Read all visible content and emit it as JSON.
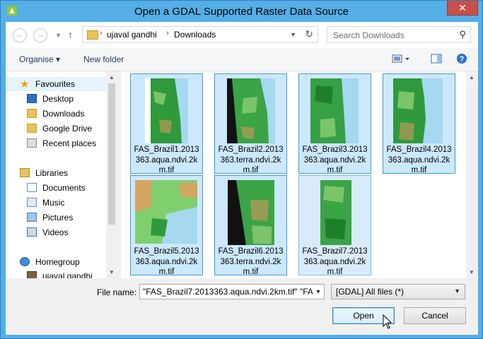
{
  "window": {
    "title": "Open a GDAL Supported Raster Data Source",
    "close_label": "✕"
  },
  "nav": {
    "back_icon": "back-arrow-icon",
    "forward_icon": "forward-arrow-icon",
    "up_icon": "up-arrow-icon",
    "breadcrumb": [
      "ujaval gandhi",
      "Downloads"
    ],
    "search_placeholder": "Search Downloads"
  },
  "toolbar": {
    "organise_label": "Organise ▾",
    "new_folder_label": "New folder"
  },
  "sidebar": {
    "favourites_label": "Favourites",
    "favourites": [
      "Desktop",
      "Downloads",
      "Google Drive",
      "Recent places"
    ],
    "libraries_label": "Libraries",
    "libraries": [
      "Documents",
      "Music",
      "Pictures",
      "Videos"
    ],
    "homegroup_label": "Homegroup",
    "homegroup_user": "ujaval gandhi"
  },
  "files": [
    {
      "name": "FAS_Brazil1.2013363.aqua.ndvi.2km.tif",
      "selected": true
    },
    {
      "name": "FAS_Brazil2.2013363.terra.ndvi.2km.tif",
      "selected": true
    },
    {
      "name": "FAS_Brazil3.2013363.aqua.ndvi.2km.tif",
      "selected": true
    },
    {
      "name": "FAS_Brazil4.2013363.aqua.ndvi.2km.tif",
      "selected": true
    },
    {
      "name": "FAS_Brazil5.2013363.aqua.ndvi.2km.tif",
      "selected": true
    },
    {
      "name": "FAS_Brazil6.2013363.terra.ndvi.2km.tif",
      "selected": true
    },
    {
      "name": "FAS_Brazil7.2013363.aqua.ndvi.2km.tif",
      "selected": true
    }
  ],
  "bottom": {
    "file_name_label": "File name:",
    "file_name_value": "\"FAS_Brazil7.2013363.aqua.ndvi.2km.tif\" \"FAS",
    "filter_value": "[GDAL] All files (*)",
    "open_label": "Open",
    "cancel_label": "Cancel"
  },
  "colors": {
    "accent": "#3c9dd6",
    "selection": "#cce8ff",
    "titlebar": "#55aee6",
    "close": "#c7504a"
  }
}
